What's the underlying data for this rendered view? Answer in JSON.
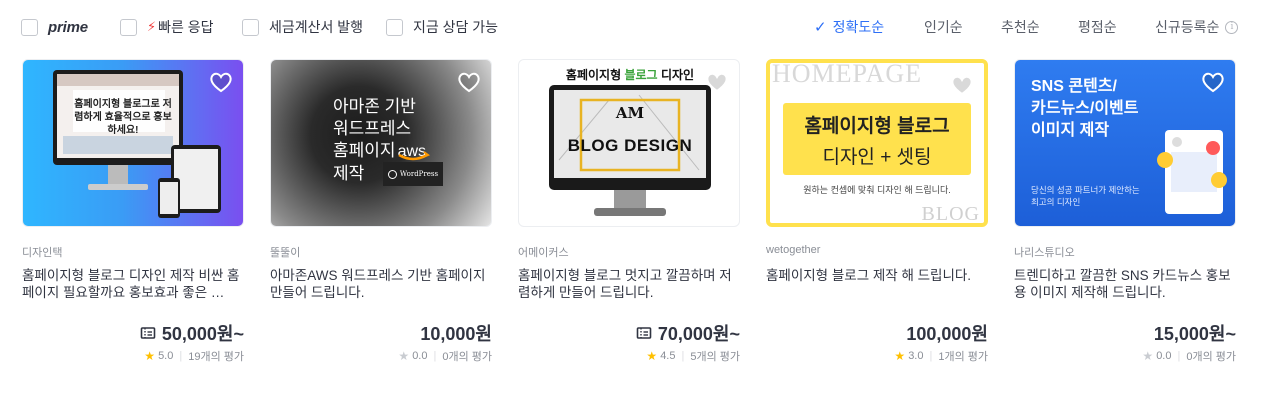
{
  "filters": [
    {
      "label": "prime",
      "checked": false
    },
    {
      "label": "빠른 응답",
      "checked": false,
      "icon": "lightning-icon"
    },
    {
      "label": "세금계산서 발행",
      "checked": false
    },
    {
      "label": "지금 상담 가능",
      "checked": false
    }
  ],
  "sort": {
    "active": "정확도순",
    "options": [
      "정확도순",
      "인기순",
      "추천순",
      "평점순",
      "신규등록순"
    ],
    "info_icon": "info-icon"
  },
  "colors": {
    "accent": "#2d6ff6",
    "star": "#ffc000",
    "bolt": "#f04040"
  },
  "cards": [
    {
      "seller": "디자인택",
      "title": "홈페이지형 블로그 디자인 제작 비싼 홈페이지 필요할까요 홍보효과 좋은 …",
      "price": "50,000원~",
      "coupon": true,
      "rating": "5.0",
      "reviews": "19개의 평가",
      "rated": true,
      "thumb_text": "홈페이지형 블로그로 저렴하게 효율적으로 홍보하세요!"
    },
    {
      "seller": "뚤뚤이",
      "title": "아마존AWS 워드프레스 기반 홈페이지 만들어 드립니다.",
      "price": "10,000원",
      "coupon": false,
      "rating": "0.0",
      "reviews": "0개의 평가",
      "rated": false,
      "thumb_text": [
        "아마존 기반",
        "워드프레스",
        "홈페이지",
        "제작"
      ],
      "thumb_aws": "aws",
      "thumb_wp": "WordPress"
    },
    {
      "seller": "어메이커스",
      "title": "홈페이지형 블로그 멋지고 깔끔하며 저렴하게 만들어 드립니다.",
      "price": "70,000원~",
      "coupon": true,
      "rating": "4.5",
      "reviews": "5개의 평가",
      "rated": true,
      "thumb_head_a": "홈페이지형",
      "thumb_head_b": "블로그",
      "thumb_head_c": "디자인",
      "thumb_logo": "AM",
      "thumb_screen": "BLOG DESIGN"
    },
    {
      "seller": "wetogether",
      "title": "홈페이지형 블로그 제작 해 드립니다.",
      "price": "100,000원",
      "coupon": false,
      "rating": "3.0",
      "reviews": "1개의 평가",
      "rated": true,
      "thumb_top": "HOMEPAGE",
      "thumb_line1": "홈페이지형 블로그",
      "thumb_line2": "디자인 + 셋팅",
      "thumb_sub": "원하는 컨셉에 맞춰 디자인 해 드립니다.",
      "thumb_bottom": "BLOG"
    },
    {
      "seller": "나리스튜디오",
      "title": "트렌디하고 깔끔한 SNS 카드뉴스 홍보용 이미지 제작해 드립니다.",
      "price": "15,000원~",
      "coupon": false,
      "rating": "0.0",
      "reviews": "0개의 평가",
      "rated": false,
      "thumb_lines": [
        "SNS 콘텐츠/",
        "카드뉴스/이벤트",
        "이미지 제작"
      ],
      "thumb_sub": [
        "당신의 성공 파트너가 제안하는",
        "최고의 디자인"
      ]
    }
  ]
}
